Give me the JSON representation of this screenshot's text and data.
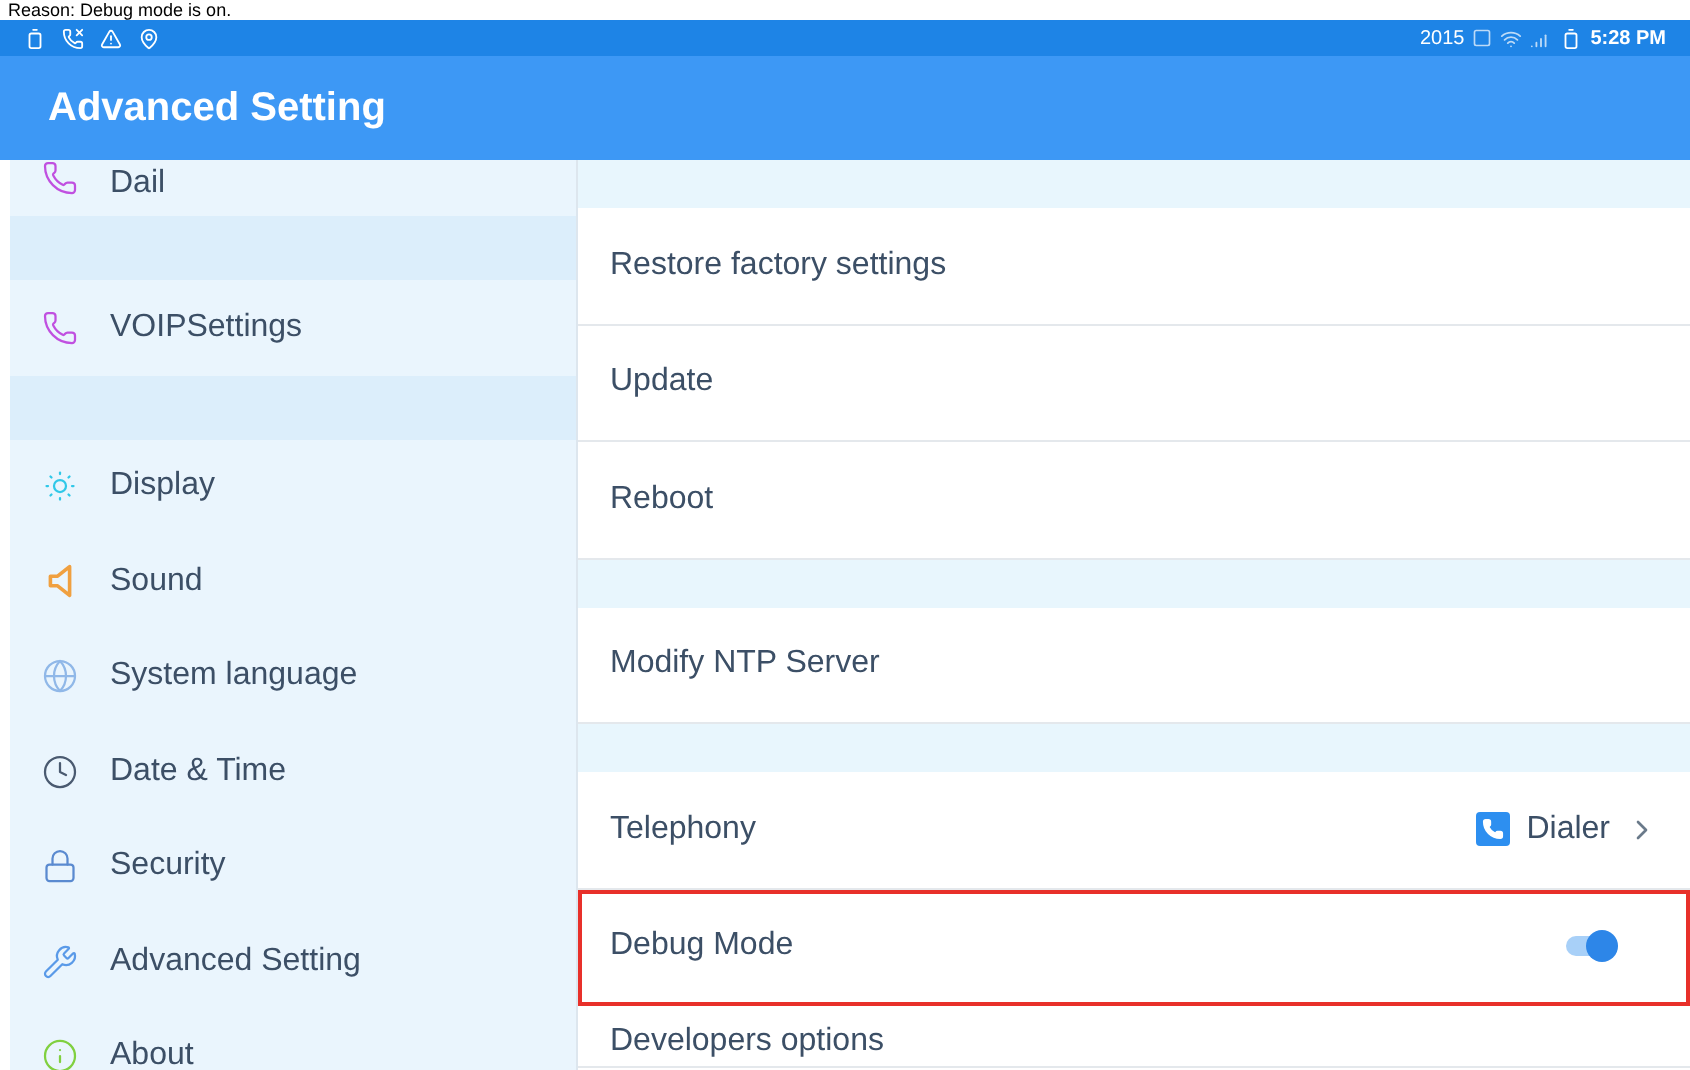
{
  "caption": "Reason: Debug mode is on.",
  "status_bar": {
    "number": "2015",
    "time": "5:28 PM"
  },
  "app_bar": {
    "title": "Advanced Setting"
  },
  "sidebar": {
    "items": [
      {
        "kind": "item",
        "label": "Dail"
      },
      {
        "kind": "gap"
      },
      {
        "kind": "item",
        "label": "VOIPSettings"
      },
      {
        "kind": "gap"
      },
      {
        "kind": "item",
        "label": "Display"
      },
      {
        "kind": "item",
        "label": "Sound"
      },
      {
        "kind": "item",
        "label": "System language"
      },
      {
        "kind": "item",
        "label": "Date & Time"
      },
      {
        "kind": "item",
        "label": "Security"
      },
      {
        "kind": "item",
        "label": "Advanced Setting"
      },
      {
        "kind": "item",
        "label": "About"
      }
    ]
  },
  "settings": {
    "rows": [
      {
        "kind": "gap"
      },
      {
        "kind": "item",
        "label": "Restore factory settings"
      },
      {
        "kind": "item",
        "label": "Update"
      },
      {
        "kind": "item",
        "label": "Reboot"
      },
      {
        "kind": "gap"
      },
      {
        "kind": "item",
        "label": "Modify NTP Server"
      },
      {
        "kind": "gap"
      },
      {
        "kind": "link",
        "label": "Telephony",
        "value": "Dialer"
      },
      {
        "kind": "switch",
        "label": "Debug Mode",
        "on": true,
        "highlighted": true
      },
      {
        "kind": "item",
        "label": "Developers options"
      }
    ]
  }
}
